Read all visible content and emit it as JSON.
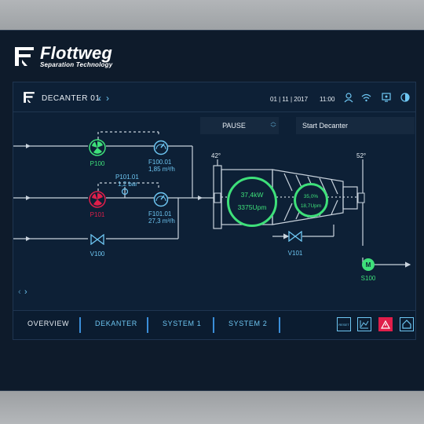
{
  "brand": {
    "name": "Flottweg",
    "tagline": "Separation Technology"
  },
  "titlebar": {
    "title": "DECANTER 01",
    "date": "01 | 11 | 2017",
    "time": "11:00",
    "icons": [
      "user-icon",
      "wifi-icon",
      "monitor-icon",
      "contrast-icon"
    ]
  },
  "controls": {
    "pause_label": "PAUSE",
    "action_label": "Start  Decanter"
  },
  "process": {
    "pumps": [
      {
        "id": "P100",
        "status": "running",
        "color": "#3ee07a"
      },
      {
        "id": "P101",
        "status": "stopped",
        "color": "#e01e4a"
      }
    ],
    "flowmeters": [
      {
        "id": "F100.01",
        "value": "1,85 m³/h"
      },
      {
        "id": "F101.01",
        "value": "27,3 m³/h"
      }
    ],
    "pressure": {
      "id": "P101.01",
      "value": "1,2 bar"
    },
    "valves": [
      "V100",
      "V101"
    ],
    "motor": {
      "id": "S100",
      "symbol": "M"
    },
    "temperatures": {
      "inlet": "42°",
      "outlet": "52°"
    },
    "bowl": {
      "power": "37,4kW",
      "speed": "3375Upm"
    },
    "scroll": {
      "differential": "35,0%",
      "speed": "18,7Upm"
    }
  },
  "nav": {
    "tabs": [
      {
        "label": "OVERVIEW",
        "active": true
      },
      {
        "label": "DEKANTER",
        "active": false
      },
      {
        "label": "SYSTEM 1",
        "active": false
      },
      {
        "label": "SYSTEM 2",
        "active": false
      }
    ],
    "tools": [
      {
        "name": "reset-icon",
        "label": "RESET"
      },
      {
        "name": "trend-chart-icon"
      },
      {
        "name": "alarm-icon",
        "color": "#e01e4a"
      },
      {
        "name": "home-icon"
      }
    ]
  },
  "colors": {
    "background": "#0d2036",
    "line": "#c9d3dd",
    "accent": "#6ec6f2",
    "running": "#3ee07a",
    "alarm": "#e01e4a"
  }
}
